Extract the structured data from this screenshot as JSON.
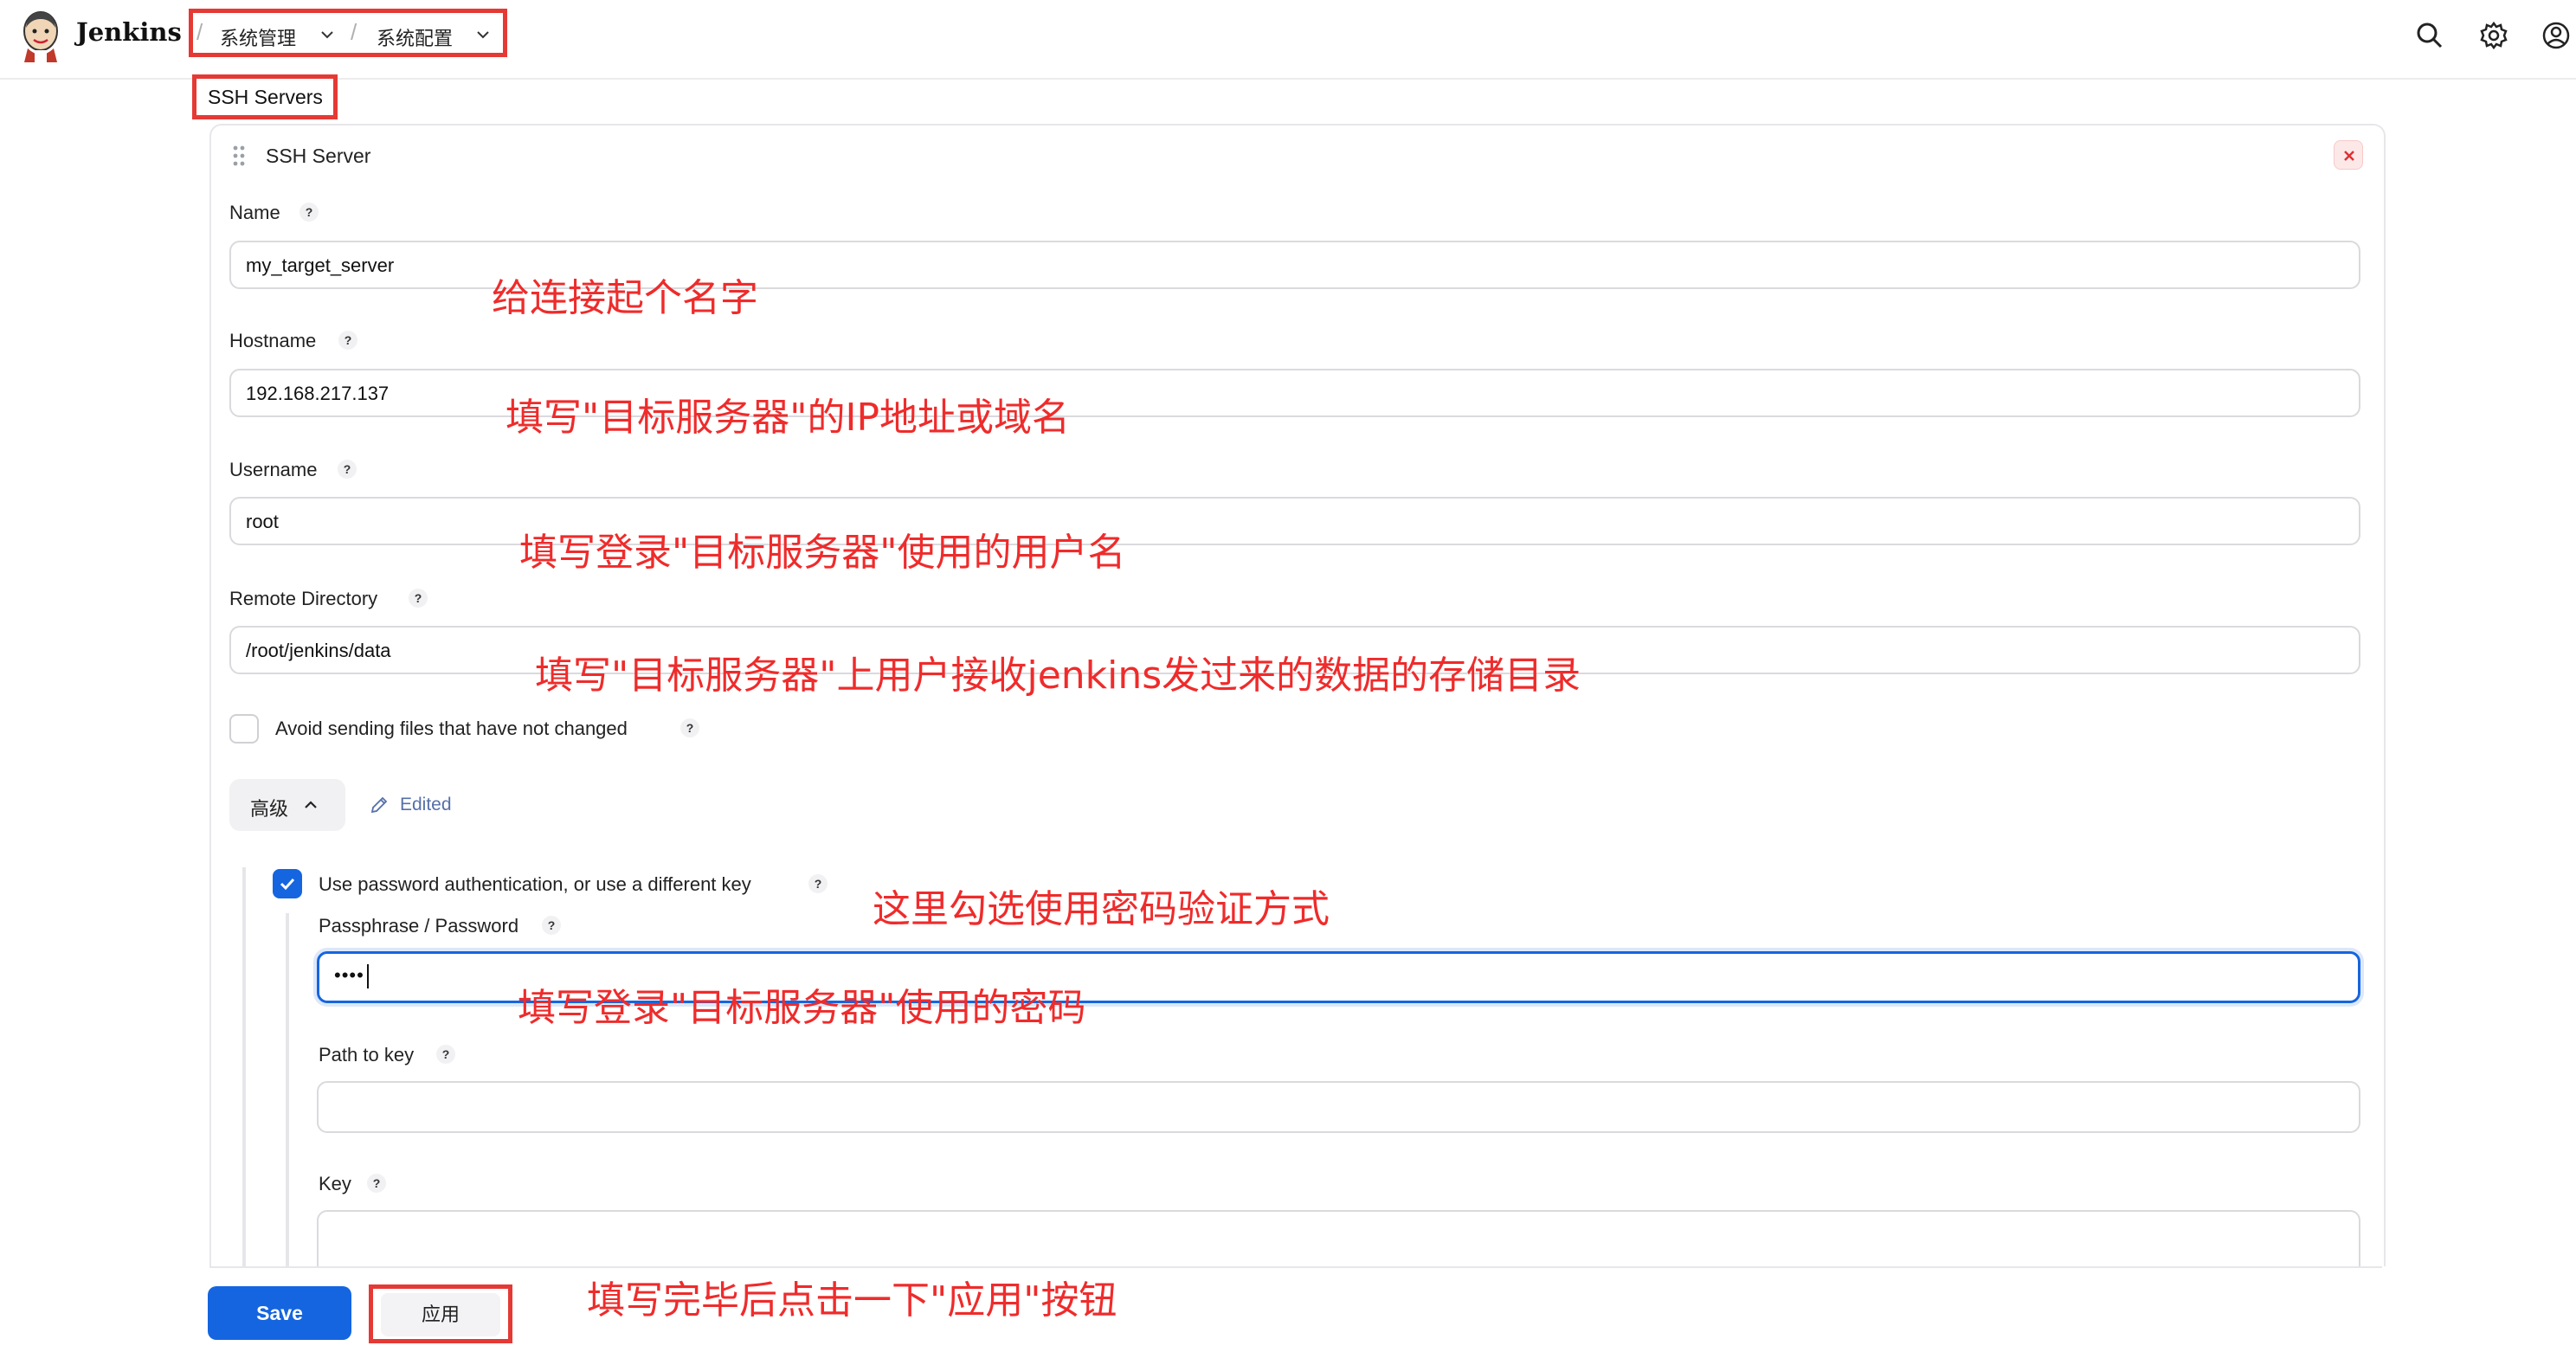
{
  "header": {
    "brand": "Jenkins",
    "breadcrumbs": [
      "系统管理",
      "系统配置"
    ]
  },
  "section_label": "SSH Servers",
  "panel": {
    "title": "SSH Server",
    "fields": {
      "name": {
        "label": "Name",
        "value": "my_target_server"
      },
      "hostname": {
        "label": "Hostname",
        "value": "192.168.217.137"
      },
      "username": {
        "label": "Username",
        "value": "root"
      },
      "remote_dir": {
        "label": "Remote Directory",
        "value": "/root/jenkins/data"
      }
    },
    "avoid_label": "Avoid sending files that have not changed",
    "advanced_label": "高级",
    "edited_label": "Edited",
    "use_password_label": "Use password authentication, or use a different key",
    "passphrase_label": "Passphrase / Password",
    "passphrase_value": "••••",
    "path_to_key_label": "Path to key",
    "key_label": "Key",
    "help": "?"
  },
  "buttons": {
    "save": "Save",
    "apply": "应用"
  },
  "annotations": {
    "name": "给连接起个名字",
    "hostname": "填写\"目标服务器\"的IP地址或域名",
    "username": "填写登录\"目标服务器\"使用的用户名",
    "remote_dir": "填写\"目标服务器\"上用户接收jenkins发过来的数据的存储目录",
    "use_password": "这里勾选使用密码验证方式",
    "password": "填写登录\"目标服务器\"使用的密码",
    "apply": "填写完毕后点击一下\"应用\"按钮"
  },
  "colors": {
    "accent": "#1565e0",
    "annotation": "#ef2b2b",
    "highlight_box": "#e53935"
  }
}
